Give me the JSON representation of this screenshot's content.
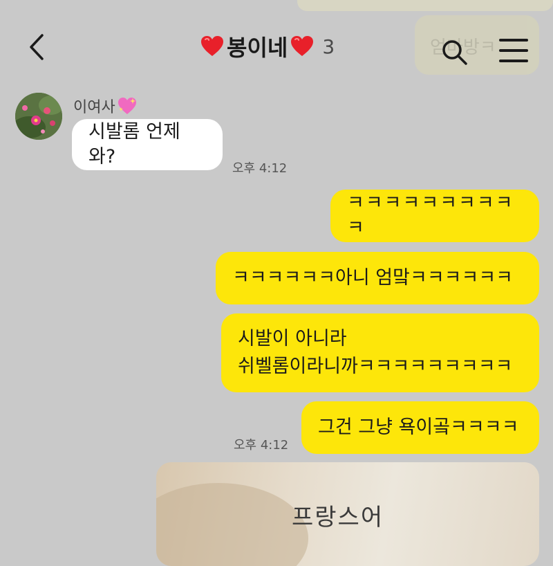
{
  "header": {
    "title": "봉이네",
    "member_count": "3",
    "ghost_text": "엄마방ㅋ"
  },
  "icons": {
    "back": "chevron-left-icon",
    "search": "search-icon",
    "menu": "menu-icon",
    "title_heart": "red-heart-icon",
    "sender_heart": "sparkling-heart-icon"
  },
  "colors": {
    "background": "#c9c9c9",
    "incoming_bubble": "#ffffff",
    "outgoing_bubble": "#fde60a"
  },
  "messages": [
    {
      "sender": "이여사",
      "direction": "incoming",
      "text": "시발롬 언제 와?",
      "time": "오후 4:12"
    },
    {
      "direction": "outgoing",
      "text": "ㅋㅋㅋㅋㅋㅋㅋㅋㅋㅋ"
    },
    {
      "direction": "outgoing",
      "text": "ㅋㅋㅋㅋㅋㅋ아니 엄맠ㅋㅋㅋㅋㅋㅋ"
    },
    {
      "direction": "outgoing",
      "lines": [
        "시발이 아니라",
        "쉬벨롬이라니까ㅋㅋㅋㅋㅋㅋㅋㅋㅋ"
      ]
    },
    {
      "direction": "outgoing",
      "text": "그건 그냥 욕이곸ㅋㅋㅋㅋ",
      "time": "오후 4:12"
    }
  ],
  "photo": {
    "caption": "프랑스어"
  }
}
